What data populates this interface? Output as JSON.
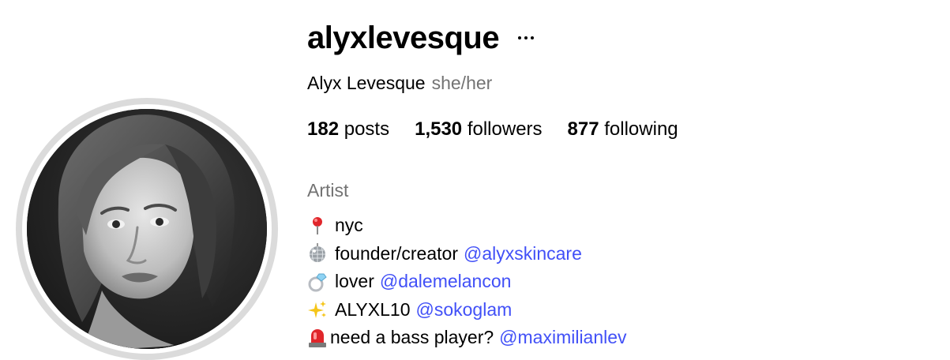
{
  "profile": {
    "username": "alyxlevesque",
    "display_name": "Alyx Levesque",
    "pronouns": "she/her",
    "category": "Artist"
  },
  "stats": {
    "posts_count": "182",
    "posts_label": "posts",
    "followers_count": "1,530",
    "followers_label": "followers",
    "following_count": "877",
    "following_label": "following"
  },
  "bio": {
    "lines": [
      {
        "icon": "round-pushpin-icon",
        "text": "nyc",
        "mention": ""
      },
      {
        "icon": "mirror-ball-icon",
        "text": "founder/creator",
        "mention": "@alyxskincare"
      },
      {
        "icon": "ring-icon",
        "text": "lover",
        "mention": "@dalemelancon"
      },
      {
        "icon": "sparkles-icon",
        "text": "ALYXL10",
        "mention": "@sokoglam"
      },
      {
        "icon": "police-light-icon",
        "text": "need a bass player?",
        "mention": "@maximilianlev"
      }
    ]
  },
  "colors": {
    "link": "#4150f7",
    "secondary_text": "#737373",
    "avatar_ring": "#dbdbdb"
  }
}
